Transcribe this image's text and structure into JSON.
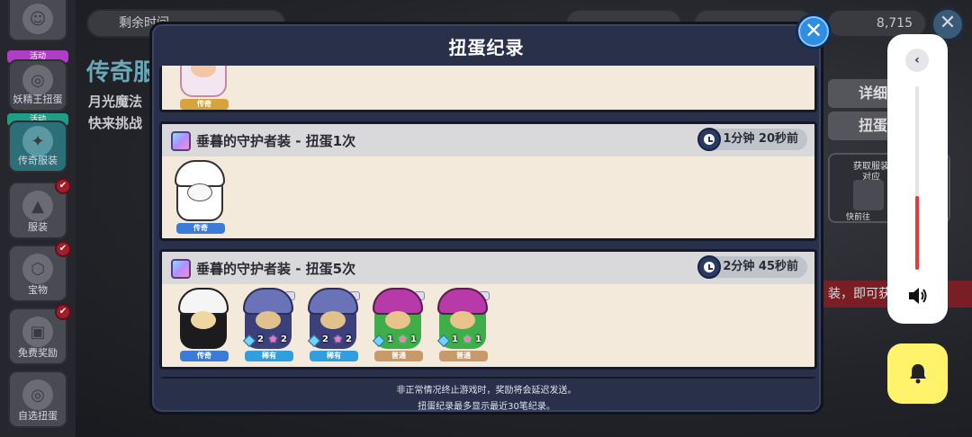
{
  "modal": {
    "title": "扭蛋纪录",
    "close_label": "✕",
    "records": [
      {
        "title": "垂暮的守护者装 - 扭蛋1次",
        "time": "1分钟 20秒前",
        "items": [
          {
            "rarity": "传奇",
            "kind": "white"
          }
        ]
      },
      {
        "title": "垂暮的守护者装 - 扭蛋5次",
        "time": "2分钟 45秒前",
        "items": [
          {
            "rarity": "传奇",
            "kind": "legend"
          },
          {
            "rarity": "稀有",
            "kind": "hood",
            "a": "2",
            "b": "2"
          },
          {
            "rarity": "稀有",
            "kind": "hood",
            "a": "2",
            "b": "2"
          },
          {
            "rarity": "普通",
            "kind": "green",
            "a": "1",
            "b": "1"
          },
          {
            "rarity": "普通",
            "kind": "green",
            "a": "1",
            "b": "1"
          }
        ]
      }
    ],
    "top_partial_rarity": "传奇",
    "footer_line1": "非正常情况终止游戏时，奖励将会延迟发送。",
    "footer_line2": "扭蛋纪录最多显示最近30笔纪录。"
  },
  "background": {
    "top_bar": {
      "time_label": "剩余时间",
      "diamonds": "8,715"
    },
    "title": "传奇服",
    "desc_line1": "月光魔法",
    "desc_line2": "快来挑战",
    "right_btn1": "详细",
    "right_btn2": "扭蛋",
    "right_banner": "装，即可获得",
    "right_card_line1": "获取服装",
    "right_card_line2": "对应",
    "right_card_footer": "快前往"
  },
  "sidebar": {
    "items": [
      {
        "tag": "活动",
        "label": "妖精王扭蛋",
        "icon": "egg-icon"
      },
      {
        "tag": "活动",
        "label": "传奇服装",
        "icon": "costume-icon"
      },
      {
        "label": "服装",
        "icon": "shirt-icon",
        "dot": "✔"
      },
      {
        "label": "宝物",
        "icon": "hexagon-icon",
        "dot": "✔"
      },
      {
        "label": "免费奖励",
        "icon": "gift-icon",
        "dot": "✔"
      },
      {
        "label": "自选扭蛋",
        "icon": "egg-icon"
      }
    ]
  },
  "system": {
    "volume_level": 0.4
  },
  "colors": {
    "modal_bg": "#29304a",
    "record_bg": "#f3eadc",
    "close_btn": "#2f8de4",
    "volume_fill": "#e23b3b",
    "bell_panel": "#fff36b"
  }
}
